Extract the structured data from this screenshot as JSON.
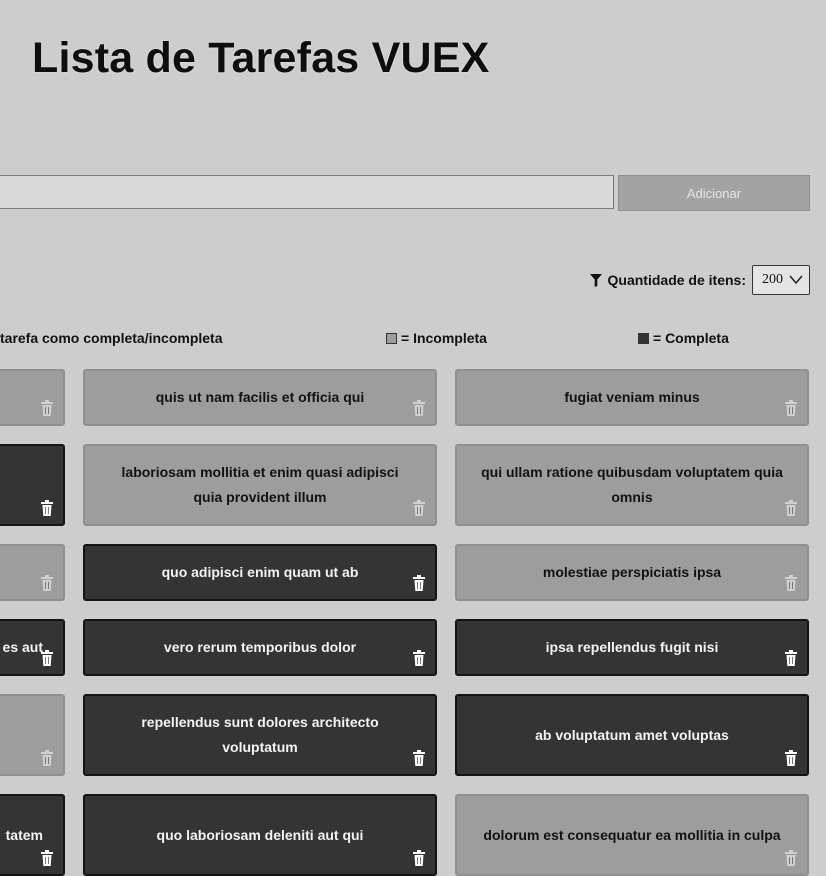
{
  "title": "Lista de Tarefas VUEX",
  "form": {
    "input_value": "",
    "add_label": "Adicionar"
  },
  "filter": {
    "label": "Quantidade de itens:",
    "selected": "200",
    "icon": "filter-icon"
  },
  "legend": {
    "hint": "tarefa como completa/incompleta",
    "incomplete": "= Incompleta",
    "complete": "= Completa"
  },
  "colors": {
    "incomplete": "#9d9d9d",
    "complete": "#343434",
    "background": "#cdcdcd"
  },
  "tasks": [
    {
      "text": "",
      "status": "incomplete"
    },
    {
      "text": "quis ut nam facilis et officia qui",
      "status": "incomplete"
    },
    {
      "text": "fugiat veniam minus",
      "status": "incomplete"
    },
    {
      "text": "",
      "status": "complete"
    },
    {
      "text": "laboriosam mollitia et enim quasi adipisci quia provident illum",
      "status": "incomplete"
    },
    {
      "text": "qui ullam ratione quibusdam voluptatem quia omnis",
      "status": "incomplete"
    },
    {
      "text": "",
      "status": "incomplete"
    },
    {
      "text": "quo adipisci enim quam ut ab",
      "status": "complete"
    },
    {
      "text": "molestiae perspiciatis ipsa",
      "status": "incomplete"
    },
    {
      "text": "es aut",
      "status": "complete"
    },
    {
      "text": "vero rerum temporibus dolor",
      "status": "complete"
    },
    {
      "text": "ipsa repellendus fugit nisi",
      "status": "complete"
    },
    {
      "text": "",
      "status": "incomplete"
    },
    {
      "text": "repellendus sunt dolores architecto voluptatum",
      "status": "complete"
    },
    {
      "text": "ab voluptatum amet voluptas",
      "status": "complete"
    },
    {
      "text": "tatem",
      "status": "complete"
    },
    {
      "text": "quo laboriosam deleniti aut qui",
      "status": "complete"
    },
    {
      "text": "dolorum est consequatur ea mollitia in culpa",
      "status": "incomplete"
    }
  ]
}
